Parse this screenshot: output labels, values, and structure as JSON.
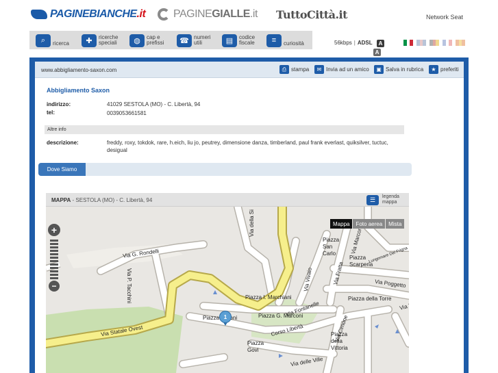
{
  "brands": {
    "paginebianche": {
      "part1": "PAGINE",
      "part2": "BIANCHE",
      "part3": ".it"
    },
    "paginegialle": {
      "part1": "PAGINE",
      "part2": "GIALLE",
      "part3": ".it"
    },
    "tuttocitta": {
      "label": "TuttoCittà.it"
    },
    "network_seat": "Network Seat"
  },
  "categories": [
    {
      "label": "ricerca",
      "icon": "magnifier-icon",
      "glyph": "⌕"
    },
    {
      "label": "ricerche\nspeciali",
      "icon": "puzzle-icon",
      "glyph": "✚"
    },
    {
      "label": "cap e\nprefissi",
      "icon": "globe-icon",
      "glyph": "◍"
    },
    {
      "label": "numeri\nutili",
      "icon": "phone-icon",
      "glyph": "☎"
    },
    {
      "label": "codice\nfiscale",
      "icon": "card-icon",
      "glyph": "▤"
    },
    {
      "label": "curiosità",
      "icon": "list-icon",
      "glyph": "≡"
    }
  ],
  "connection": {
    "speed": "56kbps",
    "type": "ADSL",
    "badge1": "A",
    "badge2": "A"
  },
  "flags": [
    {
      "name": "flag-it",
      "colors": [
        "#009246",
        "#ffffff",
        "#ce2b37"
      ]
    },
    {
      "name": "flag-en",
      "colors": [
        "#b8c4d8",
        "#e8c8c8",
        "#b8c4d8"
      ]
    },
    {
      "name": "flag-de",
      "colors": [
        "#b0b0b0",
        "#e0a8a0",
        "#f0d890"
      ]
    },
    {
      "name": "flag-fr",
      "colors": [
        "#b8c4e0",
        "#ffffff",
        "#f0b8b8"
      ]
    },
    {
      "name": "flag-es",
      "colors": [
        "#f0c0a0",
        "#f5e0a0",
        "#f0c0a0"
      ]
    }
  ],
  "toolbar": {
    "url": "www.abbigliamento-saxon.com",
    "stampa": "stampa",
    "invia": "Invia ad un amico",
    "salva": "Salva in rubrica",
    "preferiti": "preferiti"
  },
  "business": {
    "name": "Abbigliamento Saxon",
    "indirizzo_label": "indirizzo:",
    "indirizzo": "41029 SESTOLA (MO) - C. Libertà, 94",
    "tel_label": "tel:",
    "tel": "0039053661581",
    "altre_info": "Altre info",
    "descrizione_label": "descrizione:",
    "descrizione": "freddy, roxy, tokdok, rare, h.eich, liu jo, peutrey, dimensione danza, timberland, paul frank everlast, quiksilver, tuctuc, desigual"
  },
  "dove_siamo": "Dove Siamo",
  "map": {
    "title_bold": "MAPPA",
    "title_rest": " - SESTOLA (MO) - C. Libertà, 94",
    "legenda": "legenda\nmappa",
    "types": [
      "Mappa",
      "Foto aerea",
      "Mista"
    ],
    "active_type": "Mappa",
    "pin_label": "1",
    "streets": [
      "Via G. Rondelli",
      "Via P. Tacchini",
      "Via Statale Ovest",
      "Via della Si",
      "Piazza I. Marchiani",
      "Piazza P... oni",
      "Via Fontanelle",
      "Piazza G. Marconi",
      "Corso Libertà",
      "Piazza\nGovi",
      "Via delle Ville",
      "Via Vivaio",
      "Via Fratta",
      "Via Marconi",
      "Piazza\nSan\nCarlo",
      "Piazza\nScarperia",
      "Via Poggetto",
      "Piazza della Torre",
      "Via Cimone",
      "Piazza\ndella\nVittoria",
      "Via Tane",
      "Lungomare Del Frigna"
    ]
  }
}
